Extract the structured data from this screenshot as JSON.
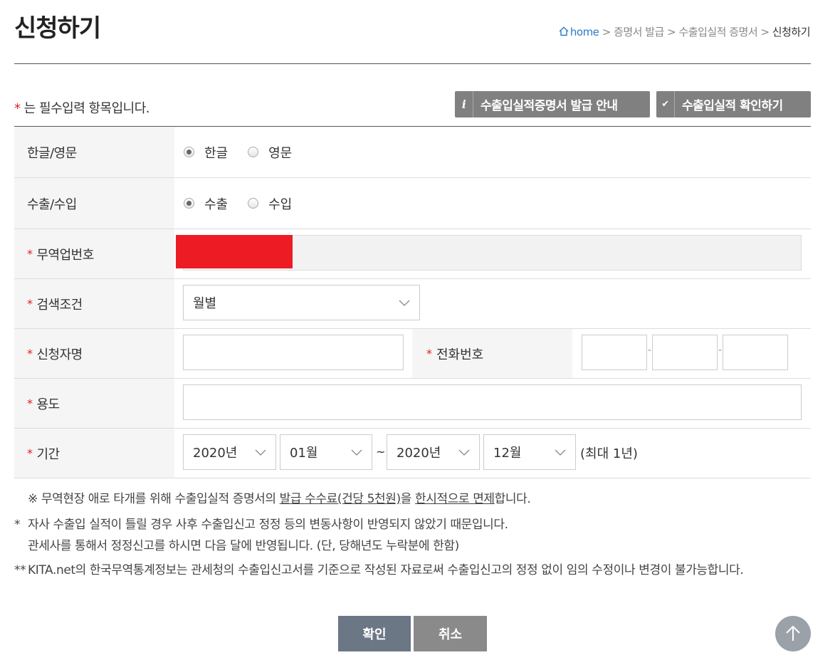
{
  "header": {
    "title": "신청하기",
    "breadcrumb": {
      "home": "home",
      "sep": ">",
      "items": [
        "증명서 발급",
        "수출입실적 증명서"
      ],
      "current": "신청하기"
    }
  },
  "required_note": {
    "mark": "*",
    "text": "는 필수입력 항목입니다."
  },
  "top_buttons": {
    "guide": {
      "icon": "i",
      "label": "수출입실적증명서 발급 안내"
    },
    "check": {
      "icon": "✔",
      "label": "수출입실적 확인하기"
    }
  },
  "form": {
    "lang": {
      "label": "한글/영문",
      "options": [
        "한글",
        "영문"
      ],
      "selected": "한글"
    },
    "trade": {
      "label": "수출/수입",
      "options": [
        "수출",
        "수입"
      ],
      "selected": "수출"
    },
    "trade_no": {
      "label": "무역업번호",
      "value": ""
    },
    "search_cond": {
      "label": "검색조건",
      "selected": "월별"
    },
    "applicant": {
      "label": "신청자명",
      "value": ""
    },
    "phone": {
      "label": "전화번호",
      "parts": [
        "",
        "",
        ""
      ],
      "sep": "-"
    },
    "purpose": {
      "label": "용도",
      "value": ""
    },
    "period": {
      "label": "기간",
      "from_year": "2020년",
      "from_month": "01월",
      "tilde": "~",
      "to_year": "2020년",
      "to_month": "12월",
      "max_note": "(최대 1년)"
    }
  },
  "notes": {
    "n1_a": "※ 무역현장 애로 타개를 위해 수출입실적 증명서의 ",
    "n1_b": "발급 수수료(건당 5천원)",
    "n1_c": "을 ",
    "n1_d": "한시적으로 면제",
    "n1_e": "합니다.",
    "n2_mark": "*",
    "n2_line1": "자사 수출입 실적이 틀릴 경우 사후 수출입신고 정정 등의 변동사항이 반영되지 않았기 때문입니다.",
    "n2_line2": "관세사를 통해서 정정신고를 하시면 다음 달에 반영됩니다. (단, 당해년도 누락분에 한함)",
    "n3_mark": "**",
    "n3_text": "KITA.net의 한국무역통계정보는 관세청의 수출입신고서를 기준으로 작성된 자료로써 수출입신고의 정정 없이 임의 수정이나 변경이 불가능합니다."
  },
  "actions": {
    "ok": "확인",
    "cancel": "취소"
  },
  "colors": {
    "required": "#e02020",
    "button_gray": "#808080",
    "ok_button": "#6b7785",
    "cancel_button": "#8a8a8a",
    "redaction": "#ed1c24"
  }
}
